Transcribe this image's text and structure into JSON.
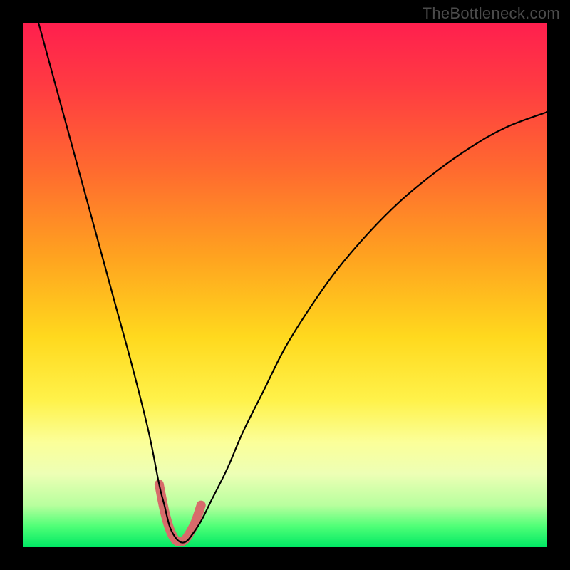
{
  "watermark": "TheBottleneck.com",
  "chart_data": {
    "type": "line",
    "title": "",
    "xlabel": "",
    "ylabel": "",
    "xlim": [
      0,
      100
    ],
    "ylim": [
      0,
      100
    ],
    "series": [
      {
        "name": "curve",
        "color": "#000000",
        "stroke_width": 2.2,
        "x": [
          3,
          6,
          9,
          12,
          15,
          18,
          21,
          24,
          26,
          27,
          28,
          29,
          30,
          31,
          32,
          34,
          36,
          39,
          42,
          46,
          50,
          55,
          60,
          66,
          72,
          78,
          85,
          92,
          100
        ],
        "y": [
          100,
          89,
          78,
          67,
          56,
          45,
          34,
          22,
          12,
          8,
          4,
          2,
          1,
          1,
          2,
          5,
          9,
          15,
          22,
          30,
          38,
          46,
          53,
          60,
          66,
          71,
          76,
          80,
          83
        ]
      },
      {
        "name": "highlight",
        "color": "#d76b6b",
        "stroke_width": 13,
        "x": [
          26,
          27,
          28,
          29,
          30,
          31,
          32,
          33,
          34
        ],
        "y": [
          12,
          7,
          3.5,
          1.5,
          1,
          1.5,
          3,
          5,
          8
        ]
      }
    ]
  }
}
